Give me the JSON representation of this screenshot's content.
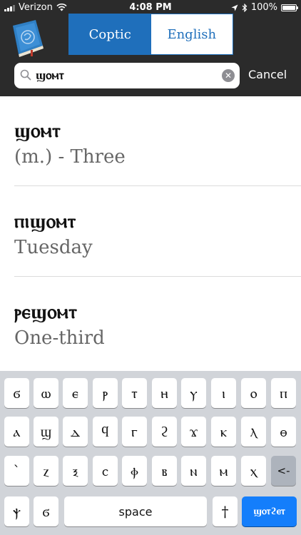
{
  "status_bar": {
    "carrier": "Verizon",
    "time": "4:08 PM",
    "battery": "100%",
    "battery_level": 1.0,
    "icons": [
      "signal-icon",
      "wifi-icon",
      "location-icon",
      "bluetooth-icon",
      "battery-icon"
    ]
  },
  "header": {
    "app_icon": "coptic-dictionary-book-icon",
    "segments": [
      {
        "label": "Coptic",
        "selected": true
      },
      {
        "label": "English",
        "selected": false
      }
    ]
  },
  "search": {
    "value": "ϣⲟⲙⲧ",
    "cancel_label": "Cancel"
  },
  "results": [
    {
      "word": "ϣⲟⲙⲧ",
      "meaning": "(m.) - Three"
    },
    {
      "word": "ⲡⲓϣⲟⲙⲧ",
      "meaning": "Tuesday"
    },
    {
      "word": "ⲣⲉϣⲟⲙⲧ",
      "meaning": "One-third"
    }
  ],
  "keyboard": {
    "row1": [
      "ϭ",
      "ⲱ",
      "ⲉ",
      "ⲣ",
      "ⲧ",
      "ⲏ",
      "ⲩ",
      "ⲓ",
      "ⲟ",
      "ⲡ"
    ],
    "row2": [
      "ⲁ",
      "ϣ",
      "ⲇ",
      "ϥ",
      "ⲅ",
      "ϩ",
      "ϫ",
      "ⲕ",
      "ⲗ",
      "ⲑ"
    ],
    "row3": [
      "`",
      "ⲍ",
      "ⲝ",
      "ⲥ",
      "ⲫ",
      "ⲃ",
      "ⲛ",
      "ⲙ",
      "ⲭ",
      "<-"
    ],
    "row4": {
      "psi": "ⲯ",
      "shima": "ϭ",
      "space": "space",
      "dagger": "†",
      "search": "ϣⲟⲧϩⲉⲧ"
    }
  },
  "colors": {
    "topbar": "#2b2b2b",
    "accent": "#1f6fbb",
    "keyboard_bg": "#d1d4d9",
    "search_key": "#147efb"
  }
}
